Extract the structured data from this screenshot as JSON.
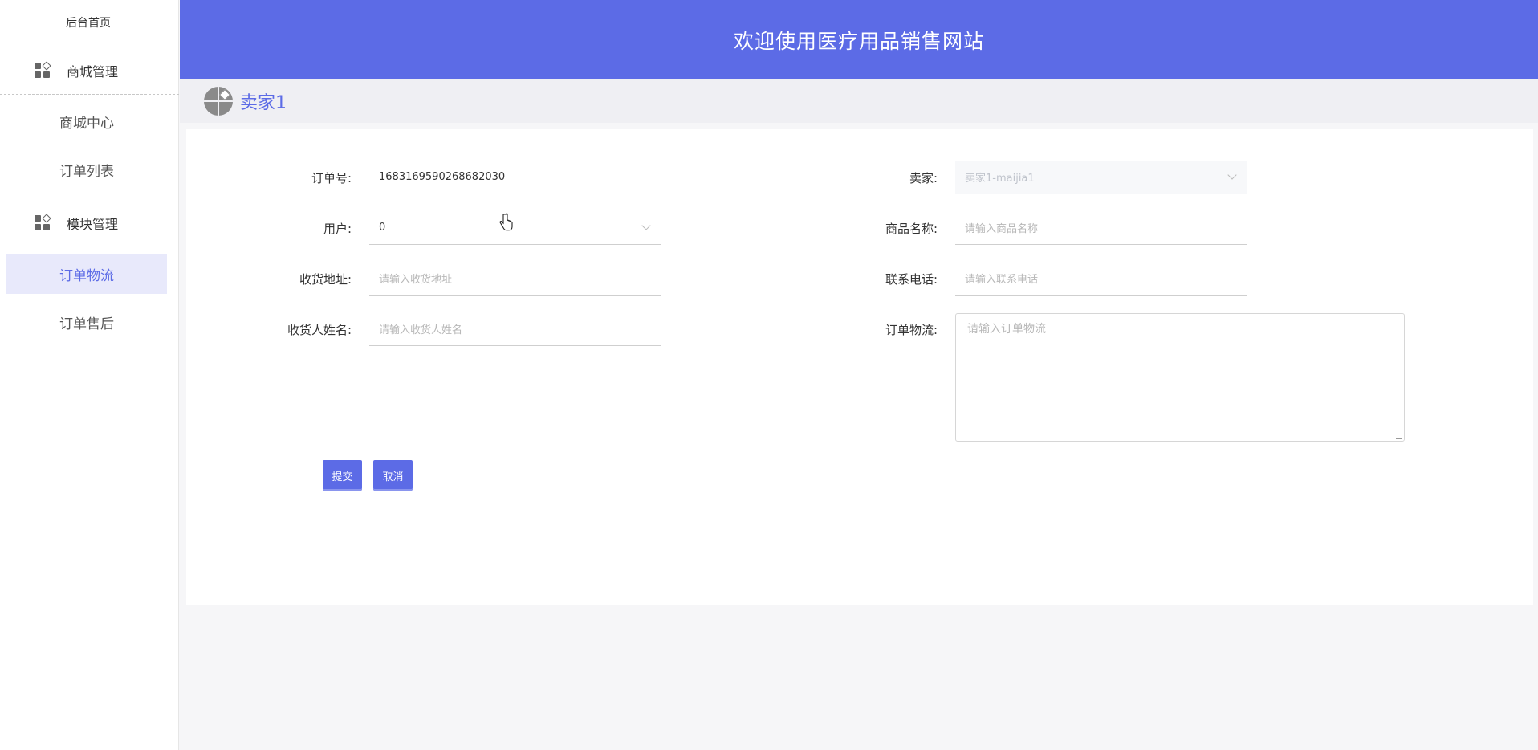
{
  "sidebar": {
    "home": "后台首页",
    "groups": [
      {
        "title": "商城管理",
        "items": [
          "商城中心",
          "订单列表"
        ]
      },
      {
        "title": "模块管理",
        "items": [
          "订单物流",
          "订单售后"
        ]
      }
    ],
    "active_item": "订单物流"
  },
  "header": {
    "title": "欢迎使用医疗用品销售网站"
  },
  "user": {
    "name": "卖家1"
  },
  "form": {
    "order_no": {
      "label": "订单号:",
      "value": "1683169590268682030"
    },
    "user": {
      "label": "用户:",
      "value": "0"
    },
    "address": {
      "label": "收货地址:",
      "placeholder": "请输入收货地址"
    },
    "receiver": {
      "label": "收货人姓名:",
      "placeholder": "请输入收货人姓名"
    },
    "seller": {
      "label": "卖家:",
      "value": "卖家1-maijia1"
    },
    "product": {
      "label": "商品名称:",
      "placeholder": "请输入商品名称"
    },
    "phone": {
      "label": "联系电话:",
      "placeholder": "请输入联系电话"
    },
    "logistics": {
      "label": "订单物流:",
      "placeholder": "请输入订单物流"
    },
    "submit": "提交",
    "cancel": "取消"
  },
  "colors": {
    "primary": "#5c6be6",
    "active_bg": "#e8e9fb"
  }
}
